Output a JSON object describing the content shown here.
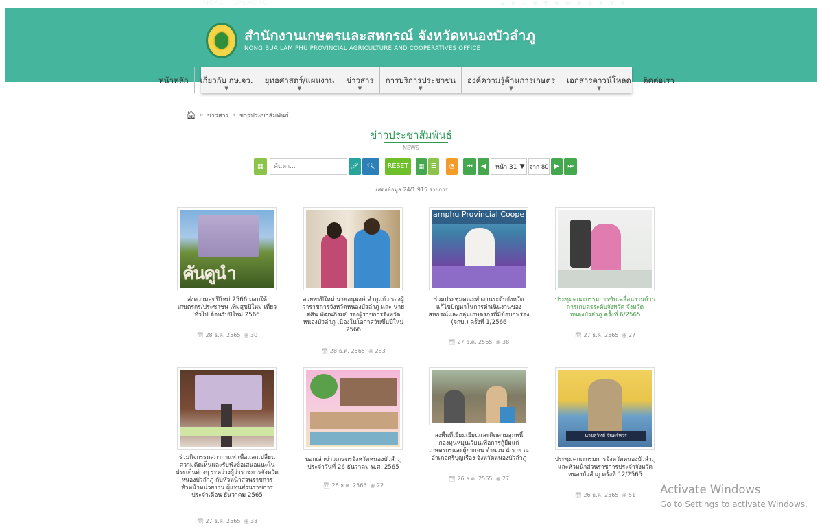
{
  "header": {
    "top_left": "MOAC · OPSMOAC ·",
    "top_right": "▲ ◆ Q ◆ ▼ ◆ ▣ ◆ ▲ ◆ ▼ ◆",
    "title": "สำนักงานเกษตรและสหกรณ์ จังหวัดหนองบัวลำภู",
    "subtitle": "NONG BUA LAM PHU PROVINCIAL AGRICULTURE AND COOPERATIVES OFFICE",
    "brand_color": "#46b59e"
  },
  "nav": {
    "items": [
      {
        "label": "หน้าหลัก",
        "dropdown": false
      },
      {
        "label": "เกี่ยวกับ กษ.จว.",
        "dropdown": true
      },
      {
        "label": "ยุทธศาสตร์/แผนงาน",
        "dropdown": true
      },
      {
        "label": "ข่าวสาร",
        "dropdown": true
      },
      {
        "label": "การบริการประชาชน",
        "dropdown": true
      },
      {
        "label": "องค์ความรู้ด้านการเกษตร",
        "dropdown": true
      },
      {
        "label": "เอกสารดาวน์โหลด",
        "dropdown": true
      },
      {
        "label": "ติดต่อเรา",
        "dropdown": false
      }
    ]
  },
  "breadcrumb": {
    "home_icon": "home-icon",
    "items": [
      "ข่าวสาร",
      "ข่าวประชาสัมพันธ์"
    ],
    "separator": "»"
  },
  "section": {
    "title": "ข่าวประชาสัมพันธ์",
    "subtitle": "NEWS"
  },
  "toolbar": {
    "search_placeholder": "ค้นหา...",
    "reset_label": "RESET",
    "page_label": "หน้า 31",
    "total_label": "จาก 80"
  },
  "showing_text": "แสดงข้อมูล 24/1,915 รายการ",
  "cards": [
    {
      "title": "ส่งความสุขปีใหม่ 2566 มอบให้ เกษตรกร/ประชาชน เพิ่มสุขปีใหม่ เที่ยวทั่วไป ต้อนรับปีใหม่ 2566",
      "date": "28 ธ.ค. 2565",
      "views": "30",
      "image_text": "คันคูนำ"
    },
    {
      "title": "อวยพรปีใหม่ นายอนุพงษ์ คำภูแก้ว รองผู้ว่าราชการจังหวัดหนองบัวลำภู และ นายศศิน พัฒนภิรมย์ รองผู้ราชการจังหวัด หนองบัวลำภู เนื่องในโอกาสวันขึ้นปีใหม่ 2566",
      "date": "28 ธ.ค. 2565",
      "views": "283",
      "image_text": ""
    },
    {
      "title": "ร่วมประชุมคณะทำงานระดับจังหวัดแก้ไขปัญหาในการดำเนินงานของสหกรณ์และกลุ่มเกษตรกรที่มีข้อบกพร่อง (จกบ.) ครั้งที่ 1/2566",
      "date": "27 ธ.ค. 2565",
      "views": "38",
      "image_text": "amphu Provincial Coope"
    },
    {
      "title": "ประชุมคณะกรรมการขับเคลื่อนงานด้านการเกษตรระดับจังหวัด จังหวัดหนองบัวลำภู ครั้งที่ 6/2565",
      "date": "27 ธ.ค. 2565",
      "views": "27",
      "image_text": ""
    },
    {
      "title": "ร่วมกิจกรรมสภากาแฟ เพื่อแลกเปลี่ยนความคิดเห็นและรับฟังข้อเสนอแนะในประเด็นต่างๆ ระหว่างผู้ว่าราชการจังหวัดหนองบัวลำภู กับหัวหน้าส่วนราชการ หัวหน้าหน่วยงาน ผู้แทนส่วนราชการ ประจำเดือน ธันวาคม 2565",
      "date": "27 ธ.ค. 2565",
      "views": "33",
      "image_text": ""
    },
    {
      "title": "บอกเล่าข่าวเกษตรจังหวัดหนองบัวลำภู ประจำวันที่ 26 ธันวาคม พ.ศ. 2565",
      "date": "26 ธ.ค. 2565",
      "views": "22",
      "image_text": ""
    },
    {
      "title": "ลงพื้นที่เยี่ยมเยียนและติดตามลูกหนี้กองทุนหมุนเวียนเพื่อการกู้ยืมแก่เกษตรกรและผู้ยากจน จำนวน 4 ราย ณ อำเภอศรีบุญเรือง จังหวัดหนองบัวลำภู",
      "date": "26 ธ.ค. 2565",
      "views": "27",
      "image_text": ""
    },
    {
      "title": "ประชุมคณะกรมการจังหวัดหนองบัวลำภู และหัวหน้าส่วนราชการประจำจังหวัดหนองบัวลำภู ครั้งที่ 12/2565",
      "date": "26 ธ.ค. 2565",
      "views": "51",
      "image_text": "นายสุวิทย์ จันทร์หวร"
    }
  ],
  "windows_notice": {
    "line1": "Activate Windows",
    "line2": "Go to Settings to activate Windows."
  }
}
